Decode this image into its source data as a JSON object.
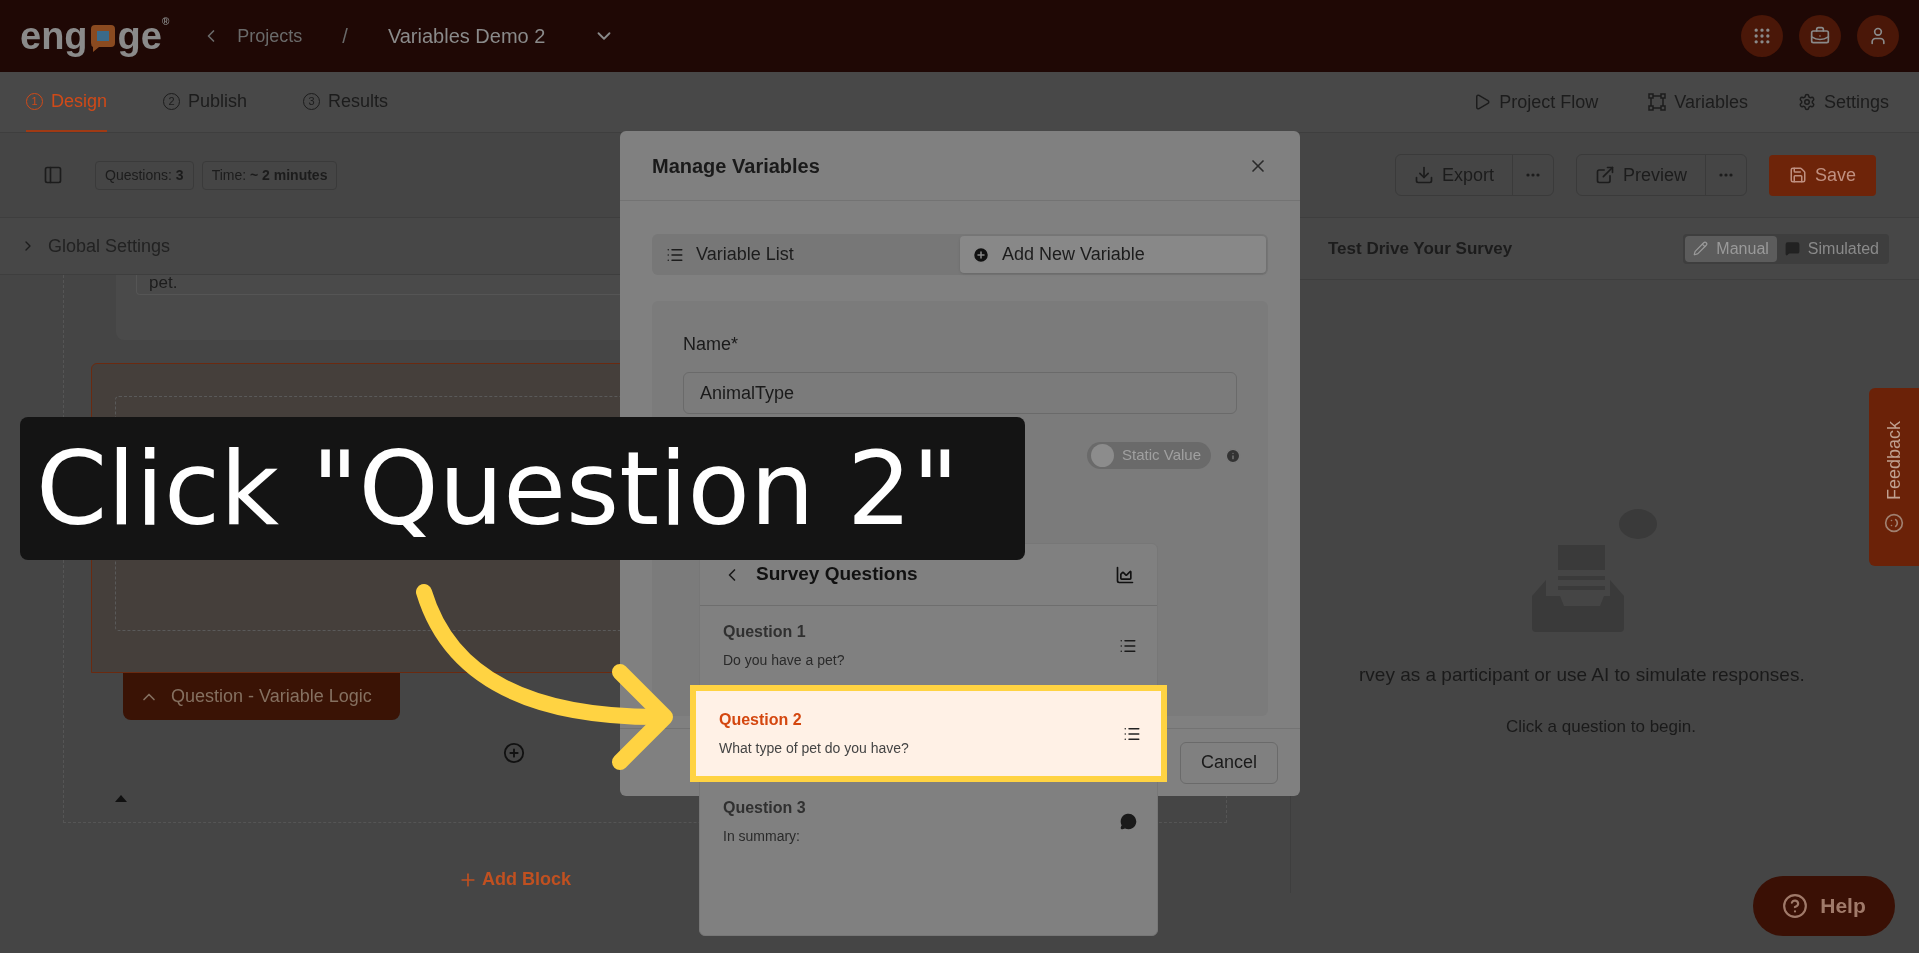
{
  "header": {
    "logo_start": "eng",
    "logo_end": "ge",
    "logo_mark": "®",
    "breadcrumb": [
      {
        "label": "Projects",
        "kind": "link"
      },
      {
        "label": "/",
        "kind": "separator"
      },
      {
        "label": "Variables Demo 2",
        "kind": "current"
      }
    ]
  },
  "tabs": [
    {
      "number": "1",
      "label": "Design",
      "selected": true
    },
    {
      "number": "2",
      "label": "Publish",
      "selected": false
    },
    {
      "number": "3",
      "label": "Results",
      "selected": false
    }
  ],
  "nav_links": [
    {
      "label": "Project Flow",
      "kind": "flow"
    },
    {
      "label": "Variables",
      "kind": "variables"
    },
    {
      "label": "Settings",
      "kind": "settings"
    }
  ],
  "toolbar": {
    "badges": [
      "Questions: **3**",
      "Time: **~ 2 minutes**"
    ],
    "export": "Export",
    "preview": "Preview",
    "save": "Save"
  },
  "global_settings": {
    "label": "Global Settings",
    "expanded": false
  },
  "editor": {
    "text_fragment": "pet.",
    "logic_tab": "Question - Variable Logic",
    "add_block": "Add Block"
  },
  "test_drive": {
    "title": "Test Drive Your Survey",
    "modes": [
      {
        "label": "Manual",
        "selected": true
      },
      {
        "label": "Simulated",
        "selected": false
      }
    ],
    "message": "rvey as a participant or use AI to simulate responses.",
    "hint": "Click a question to begin."
  },
  "modal": {
    "title": "Manage Variables",
    "tabs": [
      {
        "label": "Variable List",
        "kind": "list",
        "selected": false
      },
      {
        "label": "Add New Variable",
        "kind": "add",
        "selected": true
      }
    ],
    "name_label": "Name*",
    "name_value": "AnimalType",
    "static_value": {
      "label": "Static Value",
      "on": false
    },
    "cancel": "Cancel"
  },
  "question_picker": {
    "title": "Survey Questions",
    "items": [
      {
        "title": "Question 1",
        "text": "Do you have a pet?",
        "kind": "choice",
        "selected": false
      },
      {
        "title": "Question 2",
        "text": "What type of pet do you have?",
        "kind": "choice",
        "selected": true
      },
      {
        "title": "Question 3",
        "text": "In summary:",
        "kind": "open",
        "selected": false
      }
    ]
  },
  "callout": {
    "text": "Click \"Question 2\""
  },
  "feedback": "Feedback",
  "help": "Help"
}
